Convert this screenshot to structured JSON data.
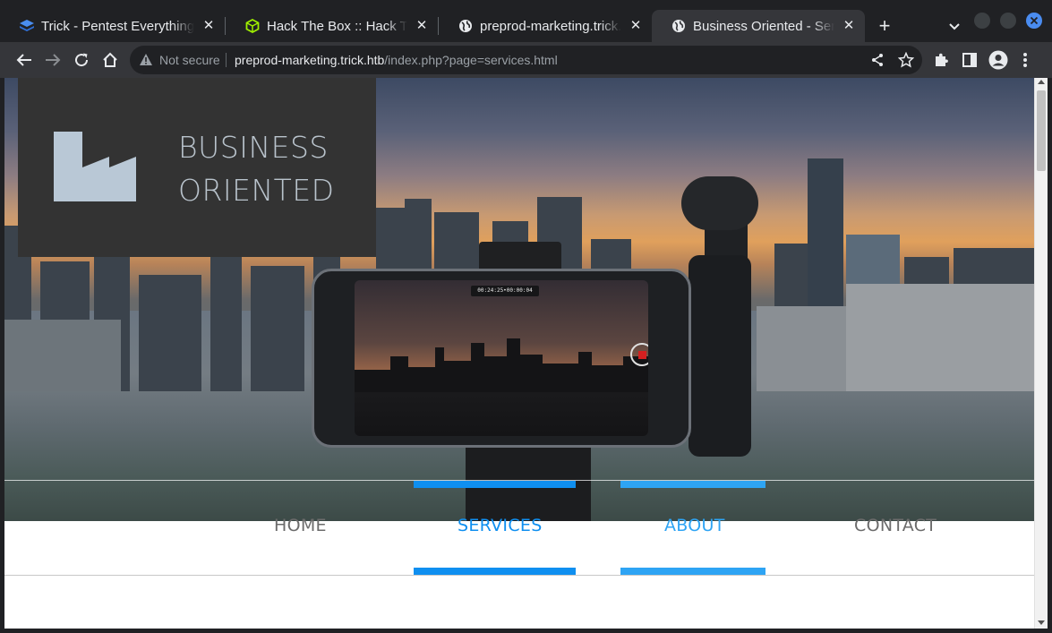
{
  "tabs": [
    {
      "title": "Trick - Pentest Everything",
      "close": "✕"
    },
    {
      "title": "Hack The Box :: Hack The Box",
      "close": "✕"
    },
    {
      "title": "preprod-marketing.trick.htb",
      "close": "✕"
    },
    {
      "title": "Business Oriented - Services",
      "close": "✕",
      "active": true
    }
  ],
  "new_tab": "+",
  "tab_search": "⌄",
  "toolbar": {
    "back_icon": "arrow-left-icon",
    "forward_icon": "arrow-right-icon",
    "reload_icon": "reload-icon",
    "home_icon": "home-icon",
    "security_label": "Not secure",
    "url_host": "preprod-marketing.trick.htb",
    "url_path": "/index.php?page=services.html"
  },
  "page": {
    "logo_line1": "BUSINESS",
    "logo_line2": "ORIENTED",
    "nav": [
      {
        "label": "HOME",
        "active": false
      },
      {
        "label": "SERVICES",
        "active": true
      },
      {
        "label": "ABOUT",
        "active": true
      },
      {
        "label": "CONTACT",
        "active": false
      }
    ],
    "recording_time": "00:24:25•00:00:04"
  },
  "colors": {
    "accent_blue": "#0f8ff0",
    "accent_blue_light": "#2ea4f4",
    "nav_text": "#6b6b6b",
    "logo_bg": "#333333",
    "logo_fg": "#b9c3cc"
  }
}
